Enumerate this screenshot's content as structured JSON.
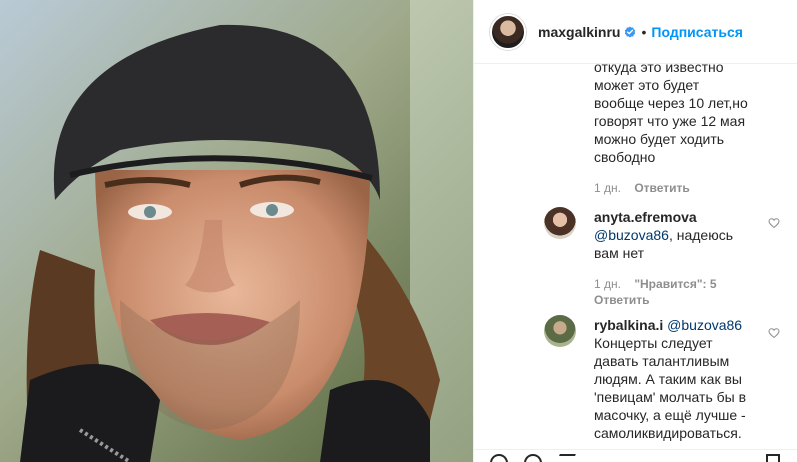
{
  "header": {
    "username": "maxgalkinru",
    "separator": "•",
    "follow_label": "Подписаться"
  },
  "comments": [
    {
      "username": "",
      "text_lines": [
        "откуда это известно",
        "может это будет",
        "вообще через 10 лет,но",
        "говорят что уже 12 мая",
        "можно будет ходить",
        "свободно"
      ],
      "time": "1 дн.",
      "reply_label": "Ответить"
    },
    {
      "username": "anyta.efremova",
      "mention": "@buzova86",
      "text_after_mention": ", надеюсь",
      "text_lines": [
        "вам нет"
      ],
      "time": "1 дн.",
      "likes_label": "\"Нравится\": 5",
      "reply_label": "Ответить"
    },
    {
      "username": "rybalkina.i",
      "mention": "@buzova86",
      "text_lines": [
        "Концерты следует",
        "давать талантливым",
        "людям. А таким как вы",
        "'певицам' молчать бы в",
        "масочку, а ещё лучше -",
        "самоликвидироваться."
      ]
    }
  ],
  "icons": {
    "verified": "verified-badge-icon",
    "heart": "heart-outline-icon"
  },
  "colors": {
    "accent": "#0095f6",
    "verified": "#3897f0",
    "text": "#262626",
    "muted": "#8e8e8e",
    "mention": "#00376b"
  }
}
